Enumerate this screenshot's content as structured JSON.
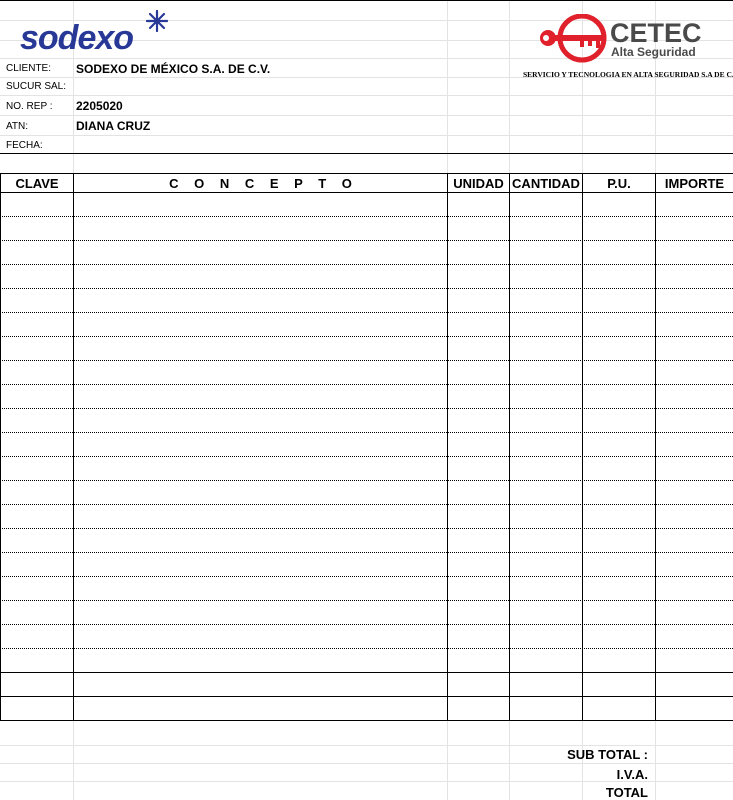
{
  "header": {
    "logo_left_text": "sodexo",
    "logo_right_title": "CETEC",
    "logo_right_subtitle": "Alta Seguridad",
    "logo_right_tagline": "SERVICIO Y TECNOLOGIA EN ALTA SEGURIDAD S.A DE C.V.",
    "brand_blue": "#283897",
    "brand_red": "#e0202a"
  },
  "info": {
    "cliente_label": "CLIENTE:",
    "cliente_value": "SODEXO DE MÉXICO S.A. DE C.V.",
    "sucursal_label": "SUCUR SAL:",
    "sucursal_value": "",
    "norep_label": "NO. REP :",
    "norep_value": "2205020",
    "atn_label": "ATN:",
    "atn_value": "DIANA CRUZ",
    "fecha_label": "FECHA:",
    "fecha_value": ""
  },
  "table": {
    "headers": {
      "clave": "CLAVE",
      "concepto": "C O N C E P T O",
      "unidad": "UNIDAD",
      "cantidad": "CANTIDAD",
      "pu": "P.U.",
      "importe": "IMPORTE"
    },
    "rows": []
  },
  "totals": {
    "subtotal_label": "SUB TOTAL :",
    "iva_label": "I.V.A.",
    "total_label": "TOTAL",
    "subtotal_value": "",
    "iva_value": "",
    "total_value": ""
  }
}
